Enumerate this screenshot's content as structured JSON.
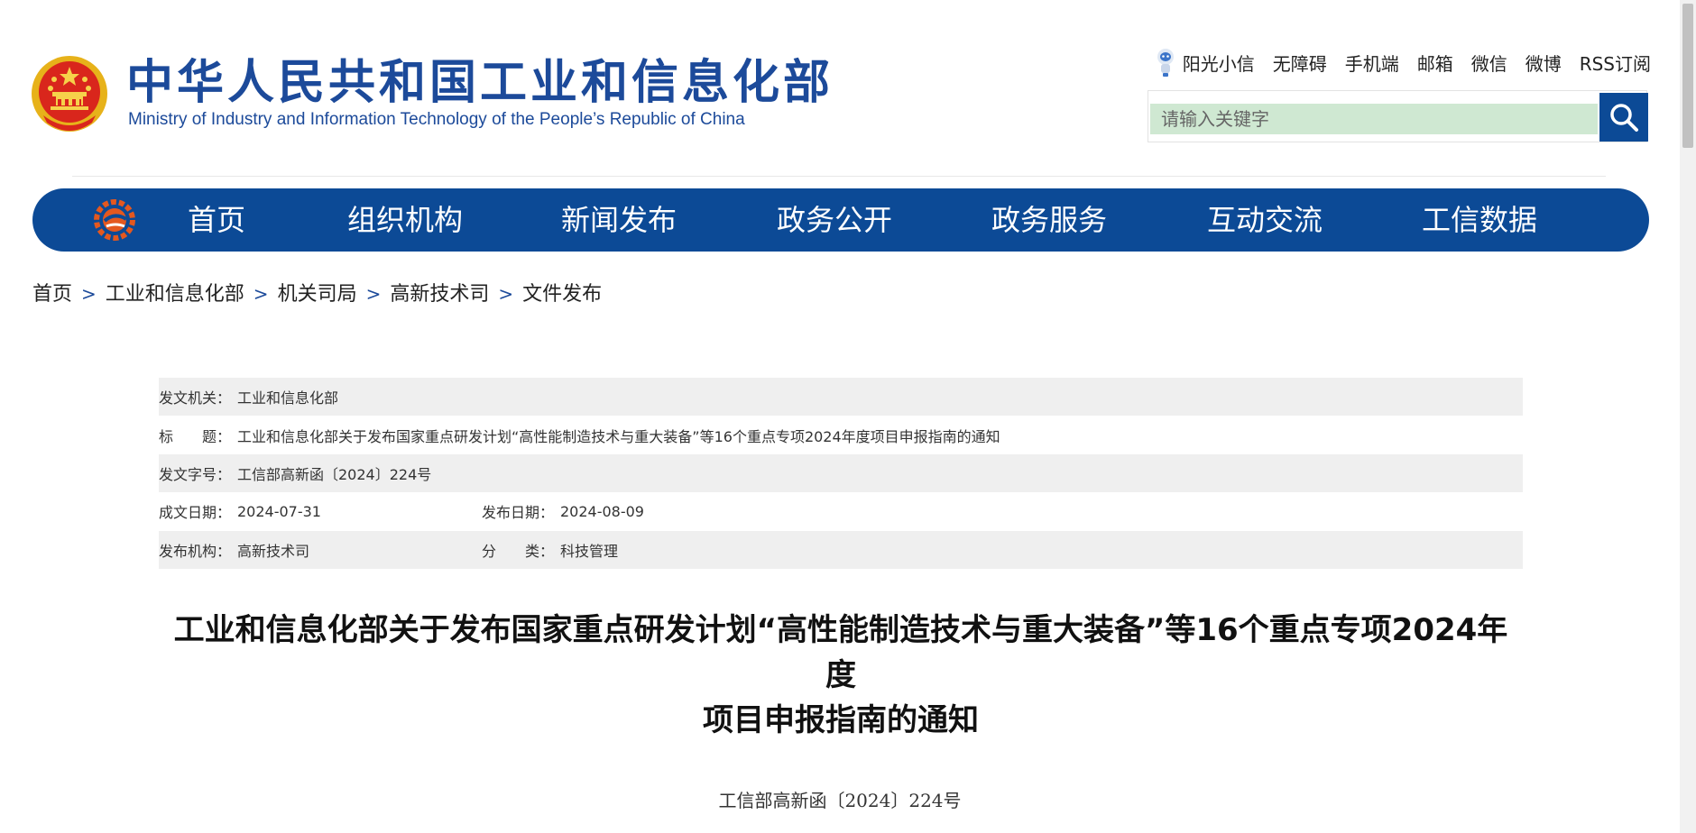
{
  "header": {
    "site_name_cn": "中华人民共和国工业和信息化部",
    "site_name_en": "Ministry of Industry and Information Technology of the People’s Republic of China",
    "top_links": [
      "阳光小信",
      "无障碍",
      "手机端",
      "邮箱",
      "微信",
      "微博",
      "RSS订阅"
    ],
    "search_placeholder": "请输入关键字",
    "search_icon": "search-icon",
    "robot_icon": "robot-mascot-icon"
  },
  "nav": {
    "items": [
      "首页",
      "组织机构",
      "新闻发布",
      "政务公开",
      "政务服务",
      "互动交流",
      "工信数据"
    ]
  },
  "breadcrumb": {
    "items": [
      "首页",
      "工业和信息化部",
      "机关司局",
      "高新技术司",
      "文件发布"
    ],
    "separator": ">"
  },
  "meta": {
    "issuer_label": "发文机关：",
    "issuer": "工业和信息化部",
    "title_label": "标　　题：",
    "title": "工业和信息化部关于发布国家重点研发计划“高性能制造技术与重大装备”等16个重点专项2024年度项目申报指南的通知",
    "doc_no_label": "发文字号：",
    "doc_no": "工信部高新函〔2024〕224号",
    "created_label": "成文日期：",
    "created": "2024-07-31",
    "published_label": "发布日期：",
    "published": "2024-08-09",
    "org_label": "发布机构：",
    "org": "高新技术司",
    "category_label": "分　　类：",
    "category": "科技管理"
  },
  "article": {
    "title_line1": "工业和信息化部关于发布国家重点研发计划“高性能制造技术与重大装备”等16个重点专项2024年度",
    "title_line2": "项目申报指南的通知",
    "doc_number": "工信部高新函〔2024〕224号"
  },
  "colors": {
    "brand_blue": "#0c4a96",
    "search_bg": "#cfe8d2",
    "meta_shade": "#efefef"
  }
}
